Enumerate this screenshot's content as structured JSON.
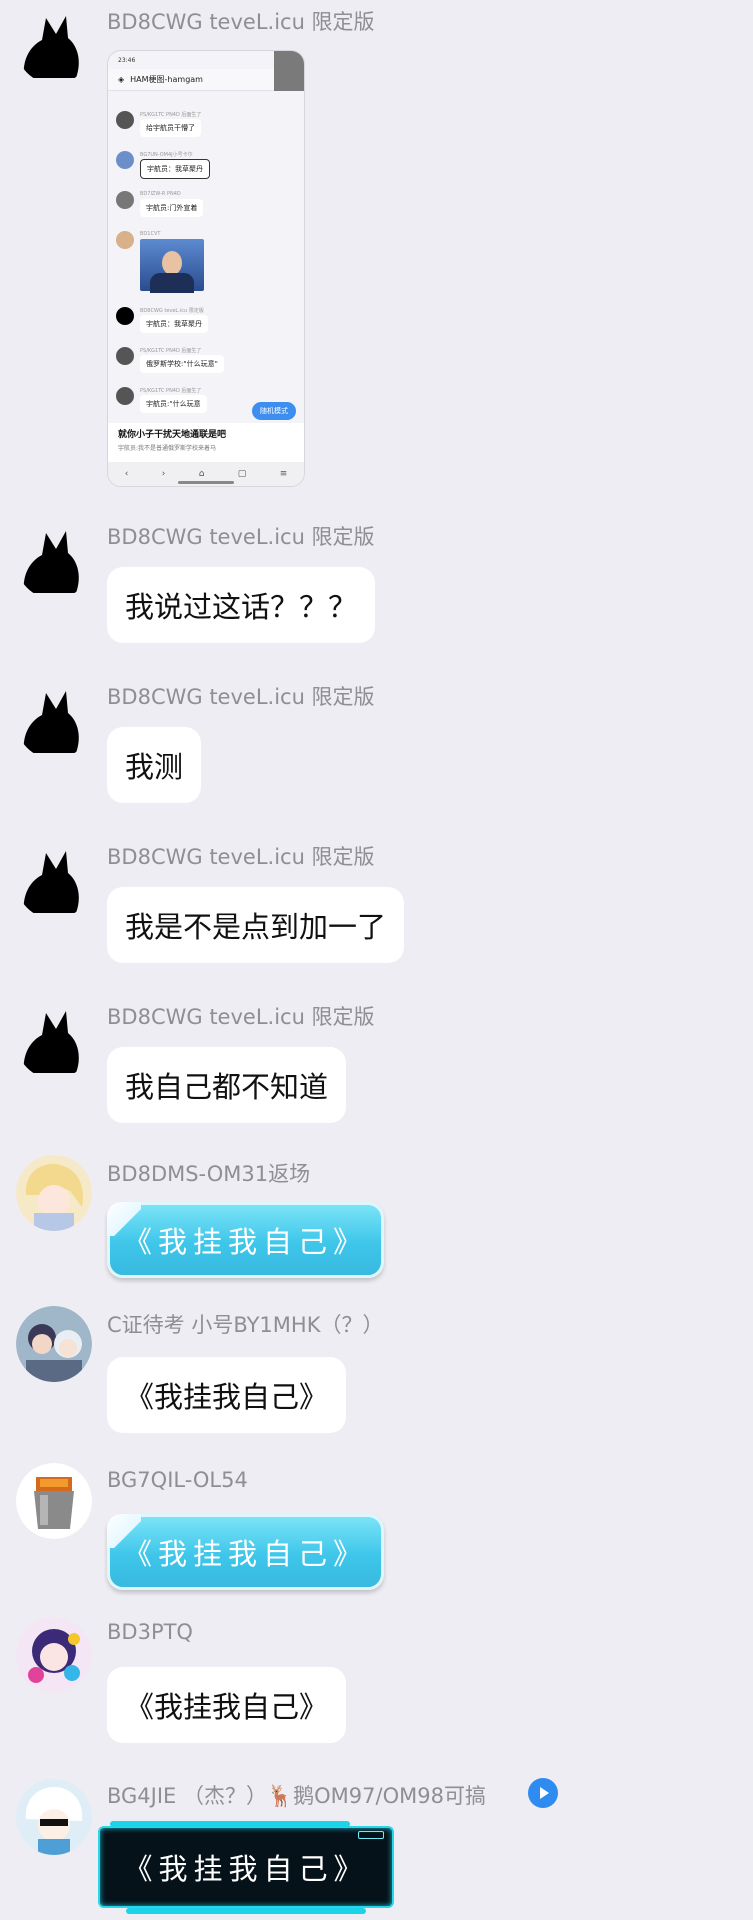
{
  "messages": [
    {
      "sender": "BD8CWG teveL.icu 限定版",
      "type": "image"
    },
    {
      "sender": "BD8CWG teveL.icu 限定版",
      "text": "我说过这话？？？"
    },
    {
      "sender": "BD8CWG teveL.icu 限定版",
      "text": "我测"
    },
    {
      "sender": "BD8CWG teveL.icu 限定版",
      "text": "我是不是点到加一了"
    },
    {
      "sender": "BD8CWG teveL.icu 限定版",
      "text": "我自己都不知道"
    },
    {
      "sender": "BD8DMS-OM31返场",
      "text": "《我挂我自己》"
    },
    {
      "sender": "C证待考 小号BY1MHK（？）",
      "text": "《我挂我自己》"
    },
    {
      "sender": "BG7QIL-OL54",
      "text": "《我挂我自己》"
    },
    {
      "sender": "BD3PTQ",
      "text": "《我挂我自己》"
    },
    {
      "sender": "BG4JIE （杰？）🦌鹅OM97/OM98可搞",
      "text": "《我挂我自己》"
    }
  ],
  "screenshot": {
    "status_time": "23:46",
    "title": "HAM梗图-hamgam",
    "rows": [
      {
        "name": "PS/KG1TC PN4D 后面生了",
        "text": "给宇航员干懵了"
      },
      {
        "name": "BG7UN-OM4J小号卡尔",
        "text": "宇航员：我草聚丹"
      },
      {
        "name": "BD7IZW-R PN4D",
        "text": "宇航员:门外宣着"
      },
      {
        "name": "BD1CVT",
        "text": ""
      },
      {
        "name": "BD8CWG teveL.icu 限定版",
        "text": "宇航员：我草聚丹"
      },
      {
        "name": "PS/KG1TC PN4D 后面生了",
        "text": "俄罗斯学校:\"什么玩意\""
      },
      {
        "name": "PS/KG1TC PN4D 后面生了",
        "text": "宇航员:\"什么玩意"
      }
    ],
    "mode_button": "随机模式",
    "article_title": "就你小子干扰天地通联是吧",
    "article_sub": "宇航员:我不是普通俄罗斯学校来着马",
    "nav": [
      "‹",
      "›",
      "⌂",
      "▢",
      "≡"
    ]
  }
}
